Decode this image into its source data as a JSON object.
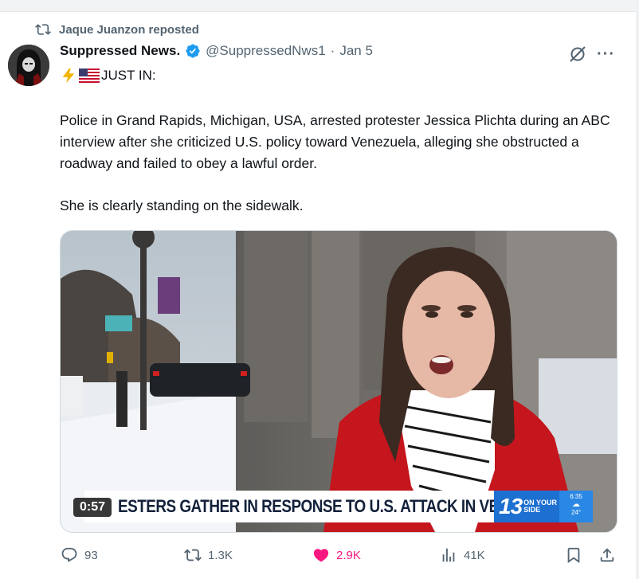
{
  "repost": {
    "label": "Jaque Juanzon reposted"
  },
  "author": {
    "name": "Suppressed News.",
    "handle": "@SuppressedNws1",
    "separator": "·",
    "date": "Jan 5"
  },
  "post": {
    "headline": "JUST IN:",
    "paragraphs": [
      "Police in Grand Rapids, Michigan, USA, arrested protester Jessica Plichta during an ABC interview after she criticized U.S. policy toward Venezuela, alleging she obstructed a roadway and failed to obey a lawful order.",
      "She is clearly standing on the sidewalk."
    ]
  },
  "video": {
    "timestamp": "0:57",
    "chyron": "ESTERS GATHER IN RESPONSE TO U.S. ATTACK IN VENEZUELA",
    "station": {
      "number": "13",
      "slogan_line1": "ON YOUR",
      "slogan_line2": "SIDE",
      "time": "6:35",
      "temp": "24°"
    }
  },
  "actions": {
    "replies": "93",
    "reposts": "1.3K",
    "likes": "2.9K",
    "views": "41K"
  },
  "colors": {
    "accent_blue": "#1d9bf0",
    "like_pink": "#f91880",
    "muted": "#536471"
  }
}
